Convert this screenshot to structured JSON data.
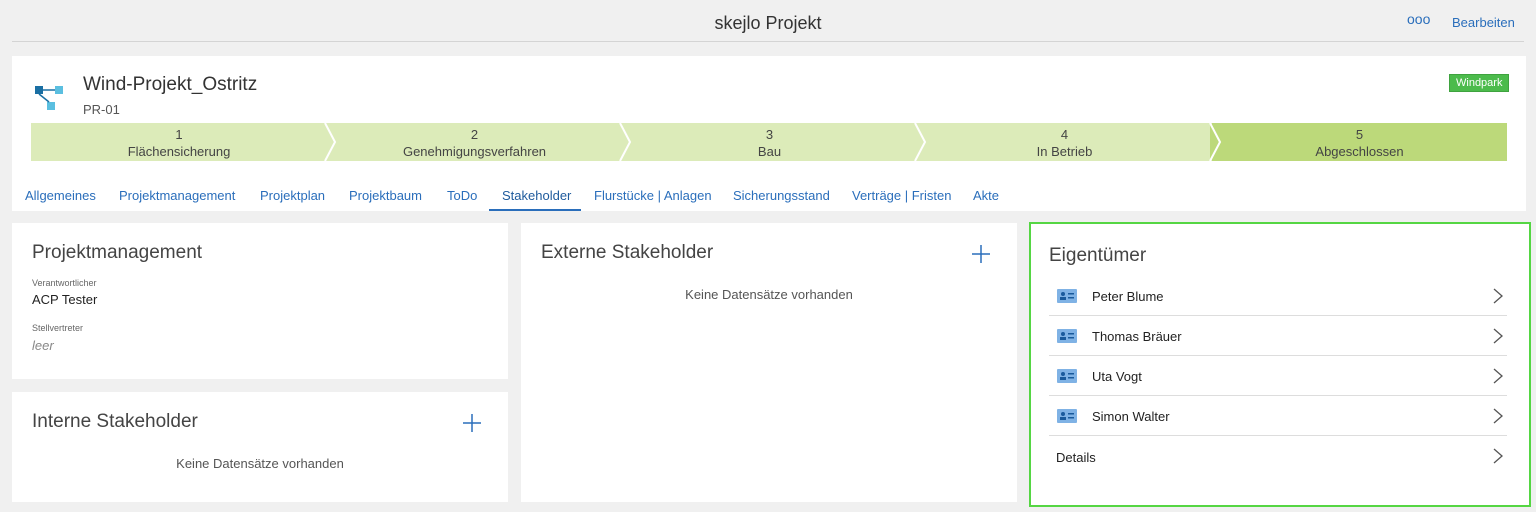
{
  "app": {
    "title": "skejlo Projekt",
    "more_label": "ooo",
    "edit_label": "Bearbeiten"
  },
  "project": {
    "name": "Wind-Projekt_Ostritz",
    "id": "PR-01",
    "badge": "Windpark"
  },
  "phases": [
    {
      "num": "1",
      "label": "Flächensicherung"
    },
    {
      "num": "2",
      "label": "Genehmigungsverfahren"
    },
    {
      "num": "3",
      "label": "Bau"
    },
    {
      "num": "4",
      "label": "In Betrieb"
    },
    {
      "num": "5",
      "label": "Abgeschlossen"
    }
  ],
  "tabs": [
    "Allgemeines",
    "Projektmanagement",
    "Projektplan",
    "Projektbaum",
    "ToDo",
    "Stakeholder",
    "Flurstücke | Anlagen",
    "Sicherungsstand",
    "Verträge | Fristen",
    "Akte"
  ],
  "pm": {
    "title": "Projektmanagement",
    "responsible_label": "Verantwortlicher",
    "responsible_value": "ACP Tester",
    "deputy_label": "Stellvertreter",
    "deputy_value": "leer"
  },
  "internal": {
    "title": "Interne Stakeholder",
    "empty": "Keine Datensätze vorhanden"
  },
  "external": {
    "title": "Externe Stakeholder",
    "empty": "Keine Datensätze vorhanden"
  },
  "owners": {
    "title": "Eigentümer",
    "items": [
      "Peter Blume",
      "Thomas Bräuer",
      "Uta Vogt",
      "Simon Walter"
    ],
    "details_label": "Details"
  },
  "colors": {
    "accent": "#2a6ebb",
    "phase_light": "#dcebb9",
    "phase_done": "#bcd97a",
    "badge": "#4cbb4c",
    "highlight": "#55d643"
  }
}
